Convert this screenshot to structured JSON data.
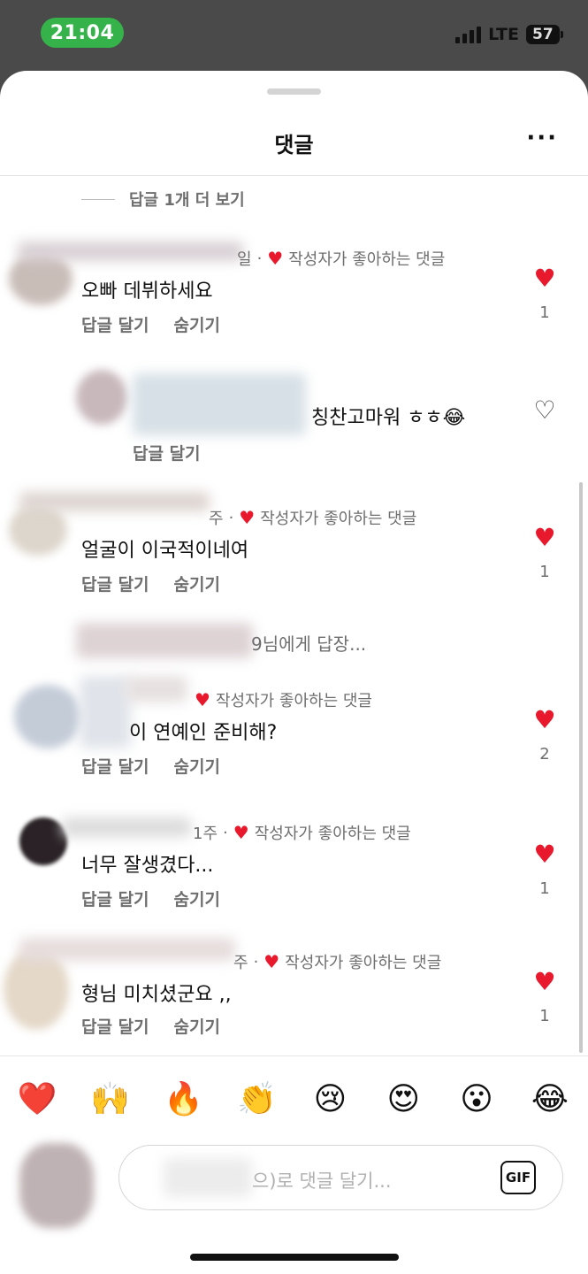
{
  "status": {
    "time": "21:04",
    "network": "LTE",
    "battery": "57"
  },
  "header": {
    "title": "댓글",
    "more_label": "···"
  },
  "view_more_replies": "답글 1개 더 보기",
  "labels": {
    "author_liked": "작성자가 좋아하는 댓글",
    "reply": "답글 달기",
    "hide": "숨기기",
    "separator": "·",
    "heart": "♥",
    "heart_outline": "♡"
  },
  "comments": [
    {
      "meta_prefix": "일",
      "text": "오빠 데뷔하세요",
      "likes": "1"
    },
    {
      "text": "칭찬고마워 ㅎㅎ😂"
    },
    {
      "meta_prefix": "주",
      "text": "얼굴이 이국적이네여",
      "likes": "1",
      "reply_to": "9님에게 답장..."
    },
    {
      "text": "이 연예인 준비해?",
      "likes": "2"
    },
    {
      "meta_prefix": "1주",
      "text": "너무 잘생겼다...",
      "likes": "1"
    },
    {
      "meta_prefix": "주",
      "text": "형님 미치셨군요 ,,",
      "likes": "1"
    }
  ],
  "emojis": [
    "❤️",
    "🙌",
    "🔥",
    "👏",
    "😢",
    "😍",
    "😮",
    "😂"
  ],
  "input": {
    "placeholder": "으)로 댓글 달기...",
    "gif_label": "GIF"
  },
  "colors": {
    "like_red": "#e8192c",
    "status_green": "#35b34a",
    "secondary_text": "#6e6e6e"
  }
}
